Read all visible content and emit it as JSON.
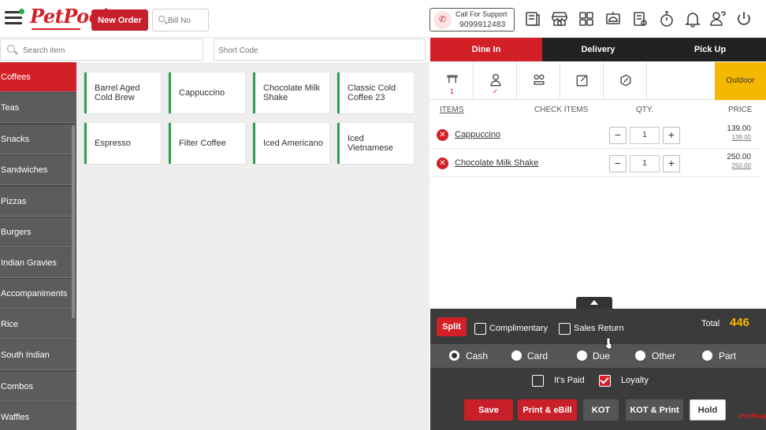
{
  "header": {
    "logo": "PetPooja",
    "new_order": "New Order",
    "bill_no_placeholder": "Bill No",
    "support_label": "Call For Support",
    "support_number": "9099912483"
  },
  "search": {
    "item_placeholder": "Search item",
    "shortcode_placeholder": "Short Code"
  },
  "categories": [
    "Coffees",
    "Teas",
    "Snacks",
    "Sandwiches",
    "Pizzas",
    "Burgers",
    "Indian Gravies",
    "Accompaniments",
    "Rice",
    "South Indian",
    "Combos",
    "Waffles"
  ],
  "active_category": "Coffees",
  "items": [
    "Barrel Aged Cold Brew",
    "Cappuccino",
    "Chocolate Milk Shake",
    "Classic Cold Coffee 23",
    "Espresso",
    "Filter Coffee",
    "Iced Americano",
    "Iced Vietnamese"
  ],
  "order_tabs": [
    "Dine In",
    "Delivery",
    "Pick Up"
  ],
  "active_tab": "Dine In",
  "table_icon_count": "1",
  "outdoor_label": "Outdoor",
  "order_columns": {
    "items": "ITEMS",
    "check_items": "CHECK ITEMS",
    "qty": "QTY.",
    "price": "PRICE"
  },
  "order_items": [
    {
      "name": "Cappuccino",
      "qty": "1",
      "price": "139.00",
      "unit_price": "139.00"
    },
    {
      "name": "Chocolate Milk Shake",
      "qty": "1",
      "price": "250.00",
      "unit_price": "250.00"
    }
  ],
  "footer": {
    "split": "Split",
    "complimentary": "Complimentary",
    "sales_return": "Sales Return",
    "total_label": "Total",
    "total_value": "446",
    "payment_modes": [
      "Cash",
      "Card",
      "Due",
      "Other",
      "Part"
    ],
    "selected_payment": "Cash",
    "its_paid": "It's Paid",
    "loyalty": "Loyalty",
    "loyalty_checked": true,
    "buttons": {
      "save": "Save",
      "print_ebill": "Print & eBill",
      "kot": "KOT",
      "kot_print": "KOT & Print",
      "hold": "Hold"
    },
    "mini_logo": "PetPooja"
  },
  "colors": {
    "brand_red": "#d32027",
    "accent_yellow": "#f5b800",
    "item_border_green": "#2e9e4f",
    "dark_panel": "#3b3b3b"
  }
}
